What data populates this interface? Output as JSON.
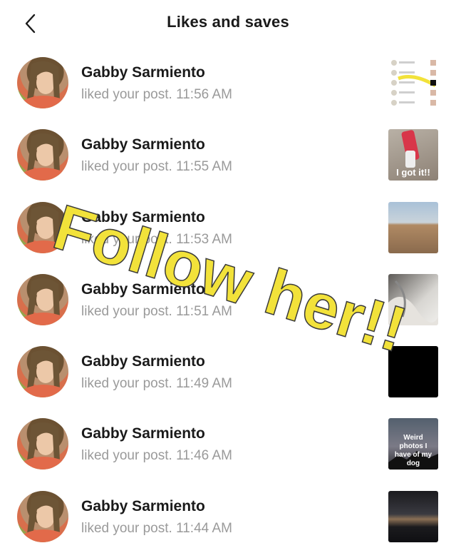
{
  "header": {
    "title": "Likes and saves",
    "back_icon": "chevron-left-icon"
  },
  "notifications": [
    {
      "user": "Gabby Sarmiento",
      "action": "liked your post.",
      "time": "11:56 AM",
      "thumbnail": "screenshot-list"
    },
    {
      "user": "Gabby Sarmiento",
      "action": "liked your post.",
      "time": "11:55 AM",
      "thumbnail": "lip-gloss",
      "caption": "I got it!!"
    },
    {
      "user": "Gabby Sarmiento",
      "action": "liked your post.",
      "time": "11:53 AM",
      "thumbnail": "beach"
    },
    {
      "user": "Gabby Sarmiento",
      "action": "liked your post.",
      "time": "11:51 AM",
      "thumbnail": "blanket"
    },
    {
      "user": "Gabby Sarmiento",
      "action": "liked your post.",
      "time": "11:49 AM",
      "thumbnail": "black"
    },
    {
      "user": "Gabby Sarmiento",
      "action": "liked your post.",
      "time": "11:46 AM",
      "thumbnail": "sunset-dog",
      "caption": "Weird photos I have of my dog"
    },
    {
      "user": "Gabby Sarmiento",
      "action": "liked your post.",
      "time": "11:44 AM",
      "thumbnail": "night-lake"
    }
  ],
  "overlay": {
    "text": "Follow her!!",
    "color": "#f2e23a"
  }
}
